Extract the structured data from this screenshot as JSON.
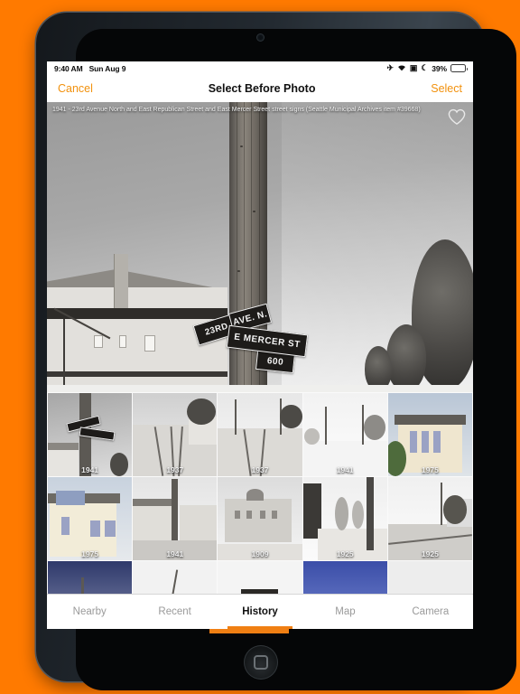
{
  "device": {
    "frame_color": "#1b2025",
    "background_color": "#FF7A00",
    "home_button_name": "home-button"
  },
  "status_bar": {
    "time": "9:40 AM",
    "date": "Sun Aug 9",
    "battery_percent": "39%",
    "battery_level": 39,
    "battery_color": "#34c759",
    "icons": [
      "airplane-mode-icon",
      "wifi-icon",
      "rotation-lock-icon",
      "do-not-disturb-icon"
    ],
    "airplane_glyph": "✈",
    "wifi_glyph": "◥",
    "lock_glyph": "▣",
    "moon_glyph": "☾"
  },
  "nav_bar": {
    "cancel_label": "Cancel",
    "title": "Select Before Photo",
    "select_label": "Select",
    "accent_color": "#F2910D"
  },
  "hero": {
    "caption": "1941 - 23rd Avenue North and East Republican Street and East Mercer Street street signs  (Seattle Municipal Archives item #39668)",
    "favorite_icon": "heart-outline-icon",
    "favorited": false,
    "signs": [
      {
        "text": "23RD",
        "name": "street-sign-23rd-ave"
      },
      {
        "text": "AVE. N.",
        "name": "street-sign-ave-n"
      },
      {
        "text": "E MERCER ST",
        "name": "street-sign-e-mercer"
      },
      {
        "text": "600",
        "name": "street-sign-block-600"
      }
    ]
  },
  "thumbnails": [
    {
      "date": "1941",
      "selected": true,
      "kind": "signpost"
    },
    {
      "date": "1937",
      "selected": false,
      "kind": "tracks"
    },
    {
      "date": "1937",
      "selected": false,
      "kind": "tracks2"
    },
    {
      "date": "1941",
      "selected": false,
      "kind": "snow"
    },
    {
      "date": "1975",
      "selected": false,
      "kind": "house-color"
    },
    {
      "date": "1975",
      "selected": false,
      "kind": "house-color2"
    },
    {
      "date": "1941",
      "selected": false,
      "kind": "street-pole"
    },
    {
      "date": "1909",
      "selected": false,
      "kind": "building"
    },
    {
      "date": "1925",
      "selected": false,
      "kind": "sidewalk"
    },
    {
      "date": "1925",
      "selected": false,
      "kind": "dirt-road"
    },
    {
      "date": "",
      "selected": false,
      "kind": "partial-a"
    },
    {
      "date": "",
      "selected": false,
      "kind": "partial-b"
    },
    {
      "date": "",
      "selected": false,
      "kind": "partial-c"
    },
    {
      "date": "",
      "selected": false,
      "kind": "partial-d"
    },
    {
      "date": "",
      "selected": false,
      "kind": "partial-e"
    }
  ],
  "tab_bar": {
    "active_index": 2,
    "accent_color": "#F07F13",
    "tabs": [
      {
        "label": "Nearby",
        "name": "tab-nearby"
      },
      {
        "label": "Recent",
        "name": "tab-recent"
      },
      {
        "label": "History",
        "name": "tab-history"
      },
      {
        "label": "Map",
        "name": "tab-map"
      },
      {
        "label": "Camera",
        "name": "tab-camera"
      }
    ]
  }
}
